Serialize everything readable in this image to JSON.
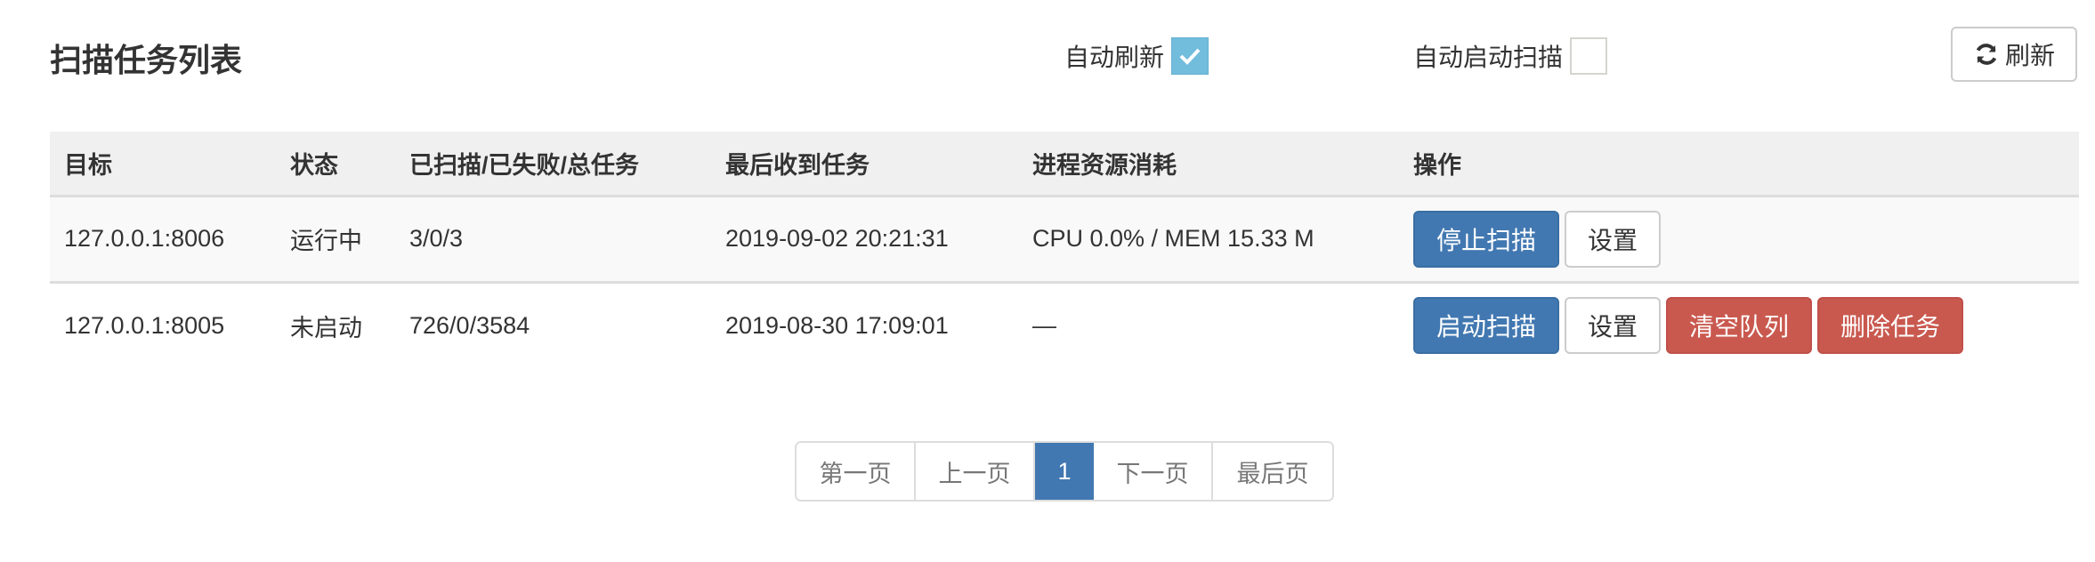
{
  "header": {
    "title": "扫描任务列表",
    "auto_refresh": {
      "label": "自动刷新",
      "checked": true
    },
    "auto_start_scan": {
      "label": "自动启动扫描",
      "checked": false
    },
    "refresh_button": {
      "label": "刷新",
      "icon": "refresh-icon"
    }
  },
  "colors": {
    "primary": "#4278b1",
    "danger": "#c9594f",
    "checkbox_checked": "#72bcdc",
    "header_bg": "#f0f0f0",
    "stripe_bg": "#f9f9f9"
  },
  "table": {
    "columns": [
      "目标",
      "状态",
      "已扫描/已失败/总任务",
      "最后收到任务",
      "进程资源消耗",
      "操作"
    ],
    "rows": [
      {
        "target": "127.0.0.1:8006",
        "status": "运行中",
        "progress": "3/0/3",
        "last_task": "2019-09-02 20:21:31",
        "resources": "CPU 0.0% / MEM 15.33 M",
        "actions": [
          "停止扫描",
          "设置"
        ]
      },
      {
        "target": "127.0.0.1:8005",
        "status": "未启动",
        "progress": "726/0/3584",
        "last_task": "2019-08-30 17:09:01",
        "resources": "—",
        "actions": [
          "启动扫描",
          "设置",
          "清空队列",
          "删除任务"
        ]
      }
    ]
  },
  "pagination": {
    "first": "第一页",
    "prev": "上一页",
    "current": "1",
    "next": "下一页",
    "last": "最后页"
  }
}
